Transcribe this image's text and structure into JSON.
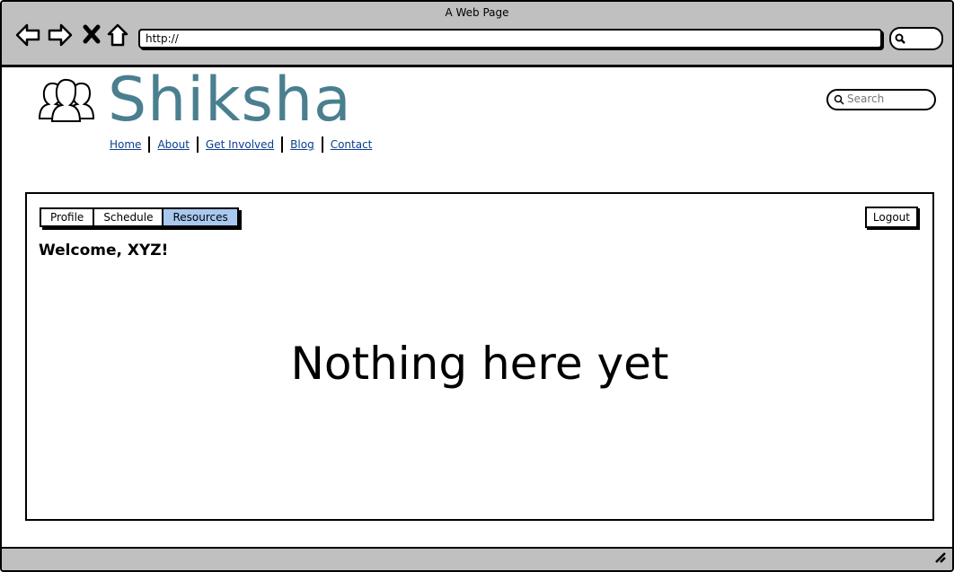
{
  "window": {
    "title": "A Web Page"
  },
  "browser": {
    "url": "http://"
  },
  "site": {
    "logo_text": "Shiksha",
    "nav": [
      "Home",
      "About",
      "Get Involved",
      "Blog",
      "Contact"
    ],
    "search_placeholder": "Search"
  },
  "panel": {
    "tabs": [
      {
        "label": "Profile"
      },
      {
        "label": "Schedule"
      },
      {
        "label": "Resources",
        "active": true
      }
    ],
    "logout_label": "Logout",
    "welcome": "Welcome, XYZ!",
    "empty_message": "Nothing here yet"
  },
  "colors": {
    "brand": "#4a7f8f",
    "active_tab": "#a8c8f0",
    "chrome": "#c0c0c0",
    "link": "#0b3d91"
  }
}
